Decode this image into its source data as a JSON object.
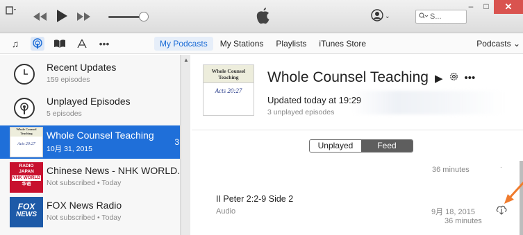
{
  "titlebar": {
    "search_placeholder": "S...",
    "colors": {
      "close": "#d9534f"
    }
  },
  "navbar": {
    "media_icons": [
      "music-icon",
      "podcast-icon",
      "books-icon",
      "apps-icon",
      "more-icon"
    ],
    "tabs": [
      {
        "label": "My Podcasts",
        "active": true
      },
      {
        "label": "My Stations",
        "active": false
      },
      {
        "label": "Playlists",
        "active": false
      },
      {
        "label": "iTunes Store",
        "active": false
      }
    ],
    "right_menu": "Podcasts ⌄"
  },
  "sidebar": {
    "items": [
      {
        "title": "Recent Updates",
        "sub": "159 episodes"
      },
      {
        "title": "Unplayed Episodes",
        "sub": "5 episodes"
      },
      {
        "title": "Whole Counsel Teaching",
        "sub": "10月 31, 2015",
        "badge": "3"
      },
      {
        "title": "Chinese News - NHK WORLD...",
        "sub": "Not subscribed • Today"
      },
      {
        "title": "FOX News Radio",
        "sub": "Not subscribed • Today"
      }
    ],
    "thumb_text": {
      "wct_line1": "Whole Counsel",
      "wct_line2": "Teaching",
      "wct_verse": "Acts 20:27",
      "nhk_line1": "RADIO",
      "nhk_line2": "JAPAN",
      "nhk_line3": "NHK WORLD",
      "nhk_line4": "华语",
      "fox_line1": "FOX",
      "fox_line2": "NEWS"
    }
  },
  "main": {
    "art": {
      "line1": "Whole Counsel",
      "line2": "Teaching",
      "verse": "Acts 20:27"
    },
    "title": "Whole Counsel Teaching",
    "updated": "Updated today at 19:29",
    "unplayed_count": "3 unplayed episodes",
    "segment": {
      "left": "Unplayed",
      "right": "Feed"
    },
    "episode_top_duration": "36 minutes",
    "episode": {
      "title": "II Peter 2:2-9 Side 2",
      "type": "Audio",
      "date": "9月 18, 2015",
      "duration": "36 minutes"
    },
    "colors": {
      "accent": "#1f6fd9",
      "arrow": "#f07b2d"
    }
  }
}
